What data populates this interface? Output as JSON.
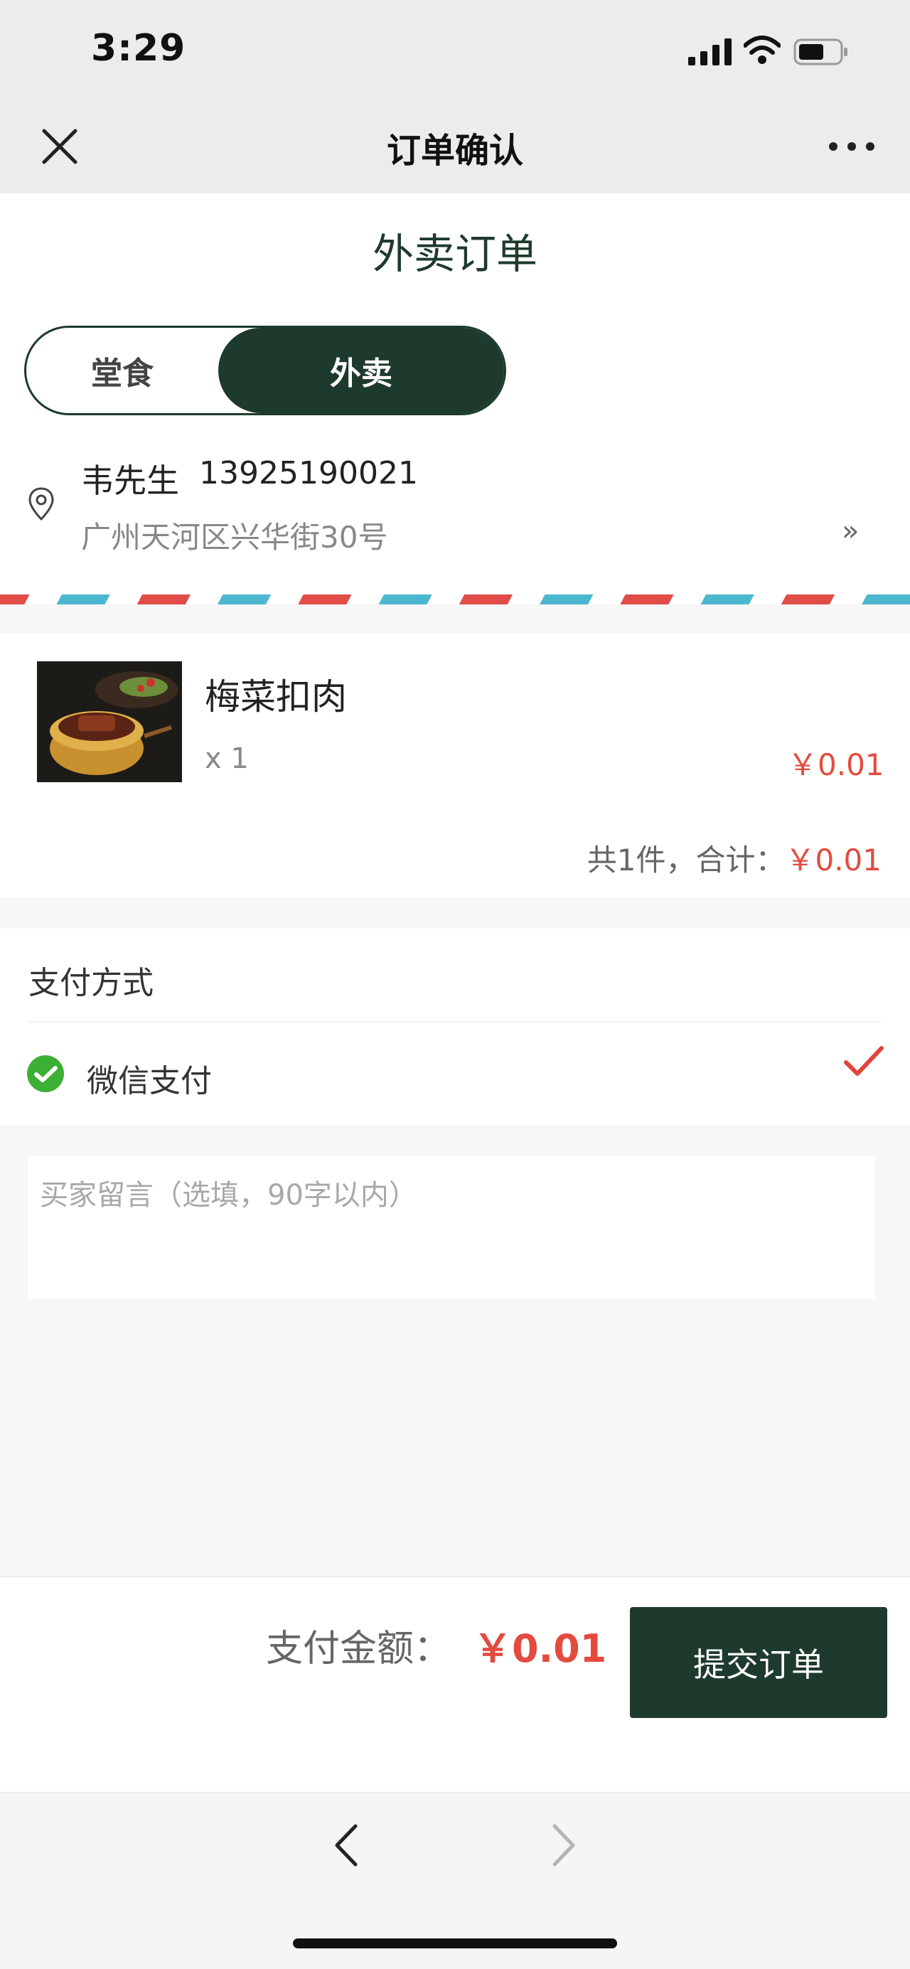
{
  "status_bar": {
    "time": "3:29"
  },
  "nav": {
    "title": "订单确认"
  },
  "page": {
    "heading": "外卖订单"
  },
  "order_type": {
    "dine_in": "堂食",
    "delivery": "外卖",
    "selected": "delivery"
  },
  "address": {
    "name": "韦先生",
    "phone": "13925190021",
    "detail": "广州天河区兴华街30号",
    "arrow": "»"
  },
  "items": [
    {
      "name": "梅菜扣肉",
      "qty": "x 1",
      "price": "￥0.01"
    }
  ],
  "summary": {
    "label": "共1件，合计：",
    "amount": "￥0.01"
  },
  "payment": {
    "heading": "支付方式",
    "method": "微信支付",
    "selected": true
  },
  "remark": {
    "placeholder": "买家留言（选填，90字以内）"
  },
  "bottom": {
    "total_label": "支付金额：",
    "total_value": "￥0.01",
    "submit_label": "提交订单"
  },
  "colors": {
    "brand": "#1e3a2c",
    "price": "#e34b3f",
    "wechat": "#3cb035"
  },
  "icons": {
    "close": "close-icon",
    "more": "more-icon",
    "pin": "location-pin-icon",
    "wechat": "wechat-pay-icon",
    "check": "check-icon",
    "back": "chevron-left-icon",
    "forward": "chevron-right-icon"
  }
}
